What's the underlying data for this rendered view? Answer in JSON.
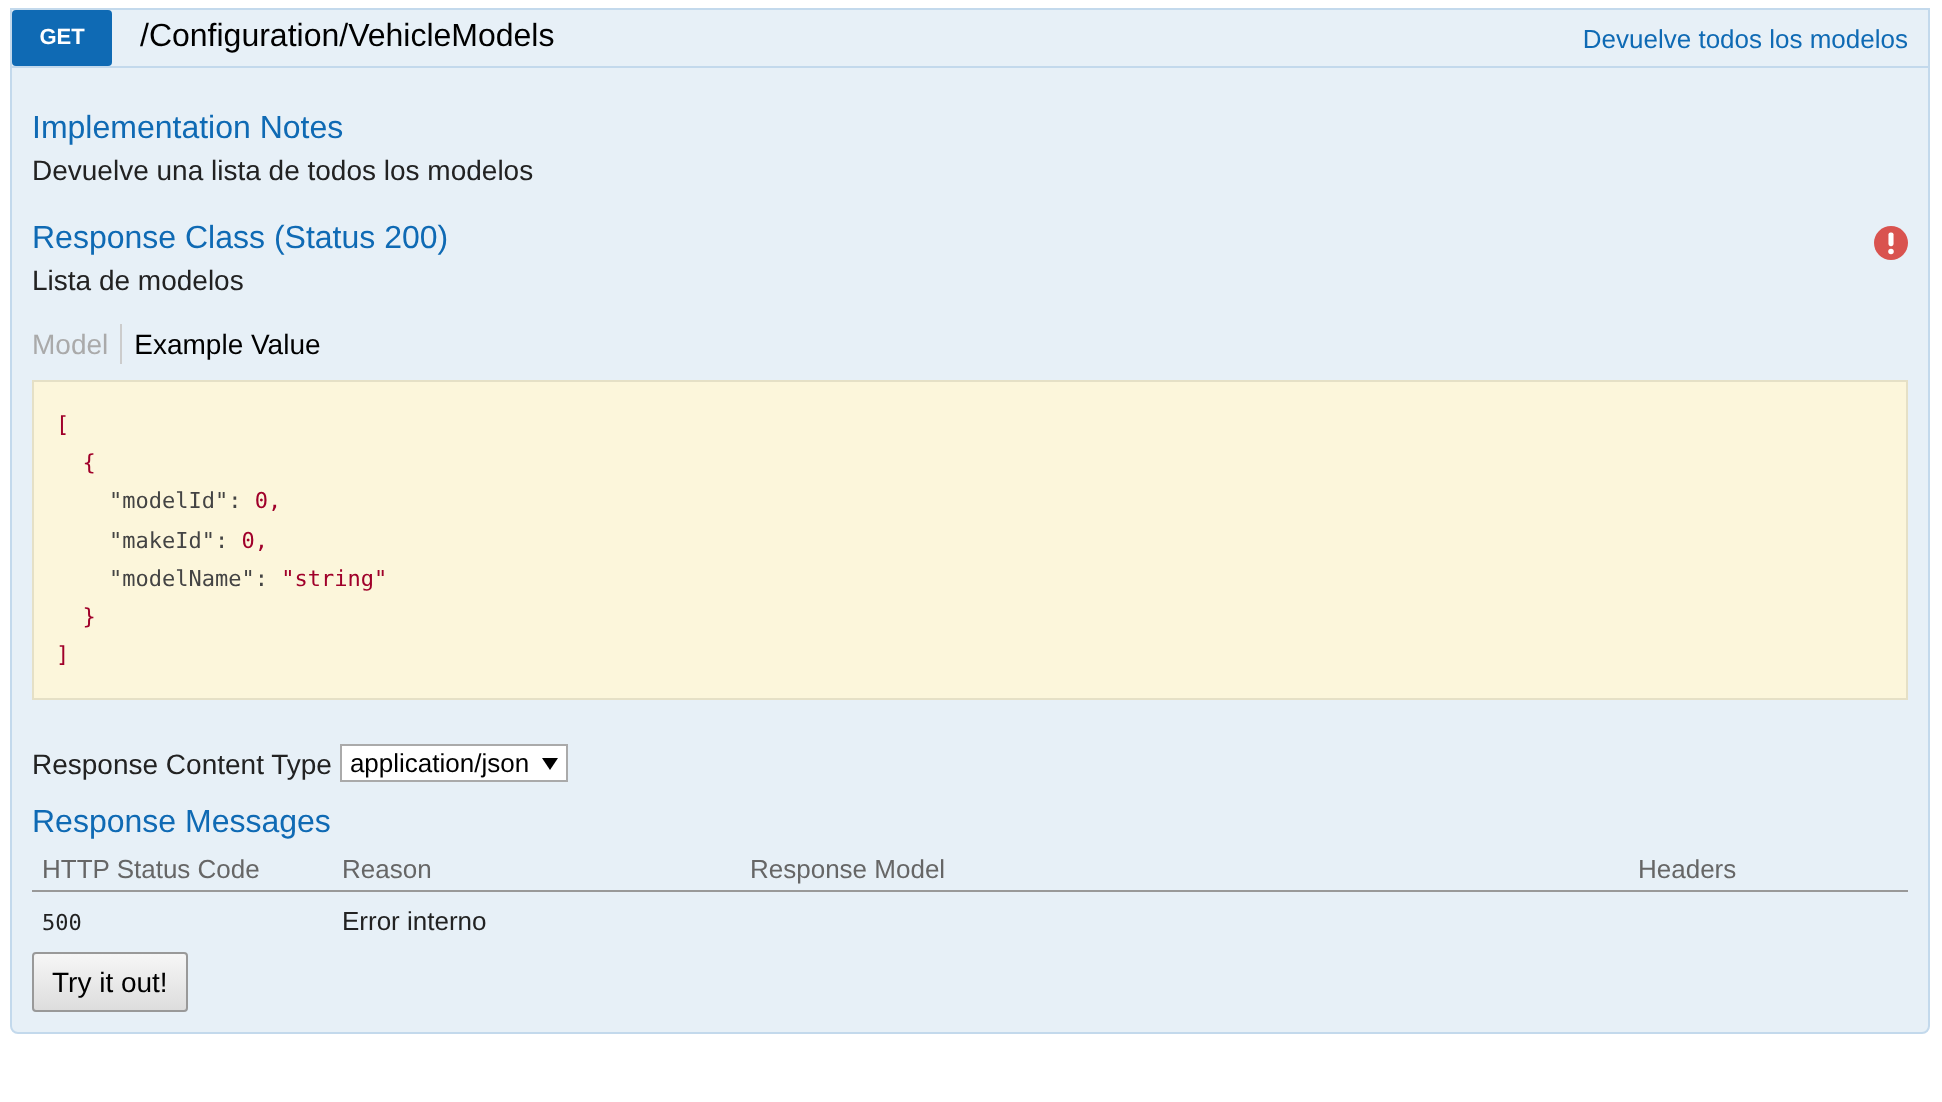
{
  "operation": {
    "method": "GET",
    "path": "/Configuration/VehicleModels",
    "summary": "Devuelve todos los modelos"
  },
  "implementation_notes": {
    "heading": "Implementation Notes",
    "text": "Devuelve una lista de todos los modelos"
  },
  "response_class": {
    "heading": "Response Class (Status 200)",
    "text": "Lista de modelos",
    "warning": true
  },
  "tabs": [
    {
      "label": "Model",
      "selected": false
    },
    {
      "label": "Example Value",
      "selected": true
    }
  ],
  "example_value": [
    "[",
    "  {",
    "    \"modelId\": 0,",
    "    \"makeId\": 0,",
    "    \"modelName\": \"string\"",
    "  }",
    "]"
  ],
  "content_type": {
    "label": "Response Content Type",
    "value": "application/json"
  },
  "response_messages": {
    "heading": "Response Messages",
    "columns": [
      "HTTP Status Code",
      "Reason",
      "Response Model",
      "Headers"
    ],
    "rows": [
      {
        "code": "500",
        "reason": "Error interno"
      }
    ]
  },
  "try_button": "Try it out!"
}
